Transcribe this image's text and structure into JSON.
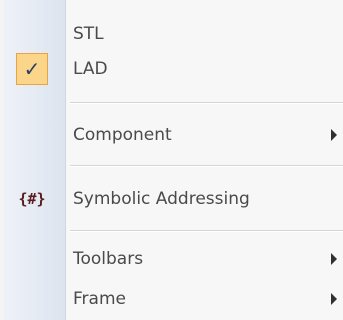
{
  "menu": {
    "items": [
      {
        "label": "STL"
      },
      {
        "label": "LAD",
        "checked_icon": "✓"
      },
      {
        "label": "Component",
        "submenu_icon": "submenu-arrow-icon"
      },
      {
        "label": "Symbolic Addressing",
        "icon_glyph": "{#}"
      },
      {
        "label": "Toolbars",
        "submenu_icon": "submenu-arrow-icon"
      },
      {
        "label": "Frame",
        "submenu_icon": "submenu-arrow-icon"
      }
    ]
  },
  "colors": {
    "checked_background": "#fbd68a",
    "checked_border": "#e6a445",
    "text": "#4a4a4a",
    "symbolic_icon": "#5a1e1e",
    "gutter": "#dde4ef"
  }
}
